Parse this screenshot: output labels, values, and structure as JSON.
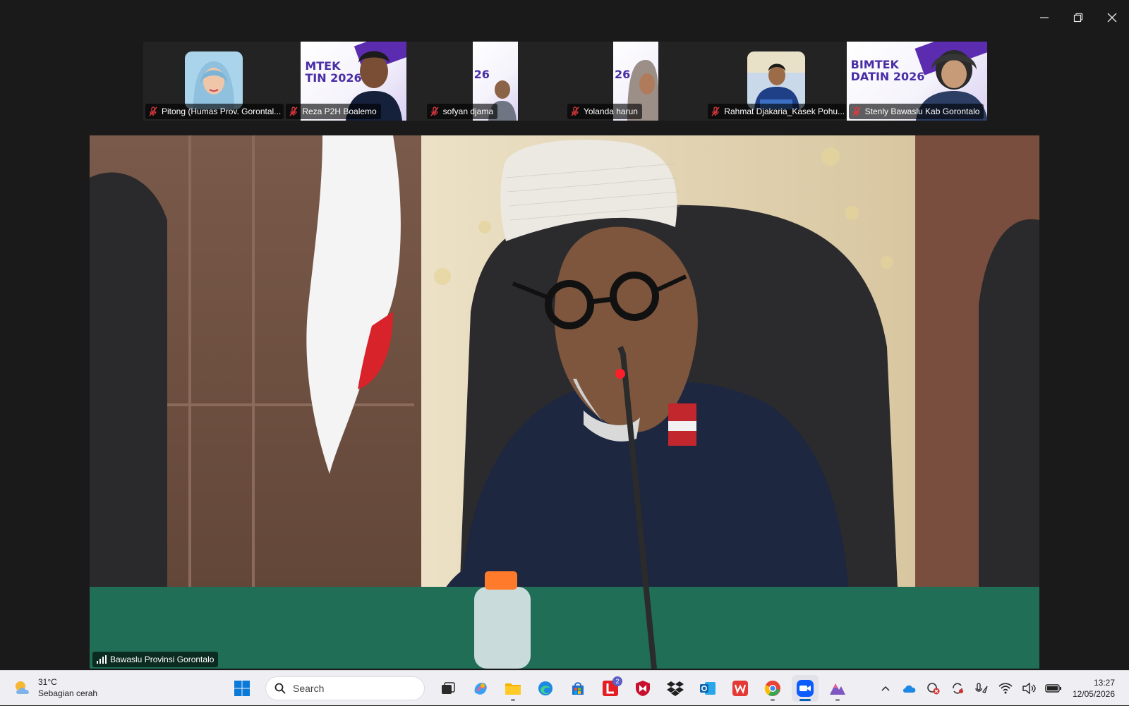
{
  "window": {
    "controls": [
      "minimize",
      "restore",
      "close"
    ]
  },
  "participants": [
    {
      "name": "Pitong (Humas Prov. Gorontal...",
      "muted": true
    },
    {
      "name": "Reza P2H Boalemo",
      "muted": true
    },
    {
      "name": "sofyan djama",
      "muted": true
    },
    {
      "name": "Yolanda harun",
      "muted": true
    },
    {
      "name": "Rahmat Djakaria_Kasek Pohu...",
      "muted": true
    },
    {
      "name": "Stenly Bawaslu Kab Gorontalo",
      "muted": true
    }
  ],
  "slide_text": {
    "bimtek_a": "BIMTEK",
    "datin_a": "DATIN 2026",
    "bimtek_b": "MTEK",
    "datin_b": "TIN 2026",
    "year_short": "26"
  },
  "speaker": {
    "name": "Bawaslu Provinsi Gorontalo"
  },
  "taskbar": {
    "weather_temp": "31°C",
    "weather_desc": "Sebagian cerah",
    "search_placeholder": "Search",
    "notification_badge": "2",
    "time": "13:27",
    "date": "12/05/2026"
  },
  "colors": {
    "accent": "#005fb8",
    "zoom_blue": "#0b5cff",
    "mute_red": "#e0393e"
  }
}
